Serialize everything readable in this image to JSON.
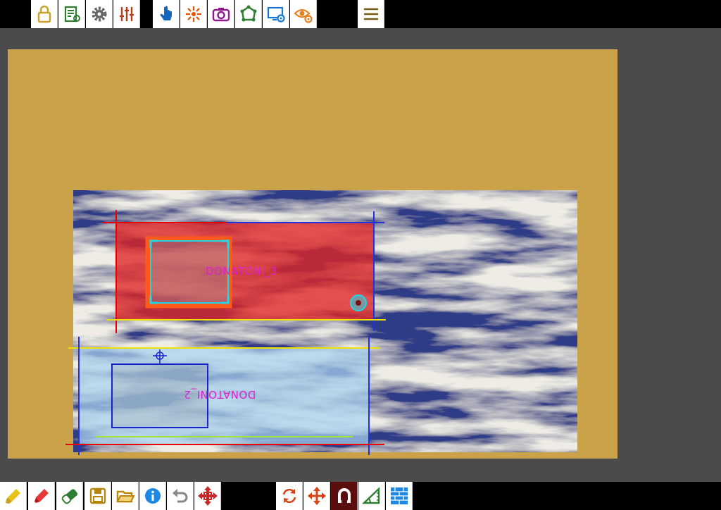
{
  "toolbar_top": {
    "group1": [
      {
        "name": "lock-icon",
        "color": "#c9a227"
      },
      {
        "name": "edit-list-icon",
        "color": "#2e7d32"
      },
      {
        "name": "gear-icon",
        "color": "#666666"
      },
      {
        "name": "sliders-icon",
        "color": "#b33a1a"
      }
    ],
    "group2": [
      {
        "name": "hand-pointer-icon",
        "color": "#1565c0"
      },
      {
        "name": "burst-icon",
        "color": "#e65100"
      },
      {
        "name": "camera-icon",
        "color": "#8e1a8e"
      },
      {
        "name": "polygon-icon",
        "color": "#2e7d32"
      },
      {
        "name": "monitor-settings-icon",
        "color": "#1976d2"
      },
      {
        "name": "eye-settings-icon",
        "color": "#e67e22"
      }
    ],
    "menu": {
      "name": "hamburger-menu-icon",
      "color": "#7a5b12"
    }
  },
  "toolbar_bottom": {
    "group1": [
      {
        "name": "highlighter-icon",
        "color": "#e8c21a"
      },
      {
        "name": "marker-icon",
        "color": "#e53935"
      },
      {
        "name": "eraser-icon",
        "color": "#2e7d32"
      },
      {
        "name": "save-icon",
        "color": "#b8860b"
      },
      {
        "name": "folder-open-icon",
        "color": "#b8860b"
      },
      {
        "name": "info-icon",
        "color": "#1e88e5"
      },
      {
        "name": "undo-icon",
        "color": "#888888"
      },
      {
        "name": "move-cross-icon",
        "color": "#c62828"
      }
    ],
    "group2": [
      {
        "name": "rotate-icon",
        "color": "#d84315"
      },
      {
        "name": "move-arrows-icon",
        "color": "#d84315"
      },
      {
        "name": "magnet-icon",
        "color": "#ffffff"
      },
      {
        "name": "measure-angle-icon",
        "color": "#2e7d32"
      },
      {
        "name": "grid-pattern-icon",
        "color": "#1e88e5"
      }
    ]
  },
  "canvas": {
    "sheet_color": "#c9a24a",
    "workspace_color": "#4b4b4b",
    "parts": [
      {
        "label": "DONATONI_3",
        "fill": "#e02424"
      },
      {
        "label": "DONATONI_2",
        "fill": "#a9d3f0"
      }
    ]
  }
}
